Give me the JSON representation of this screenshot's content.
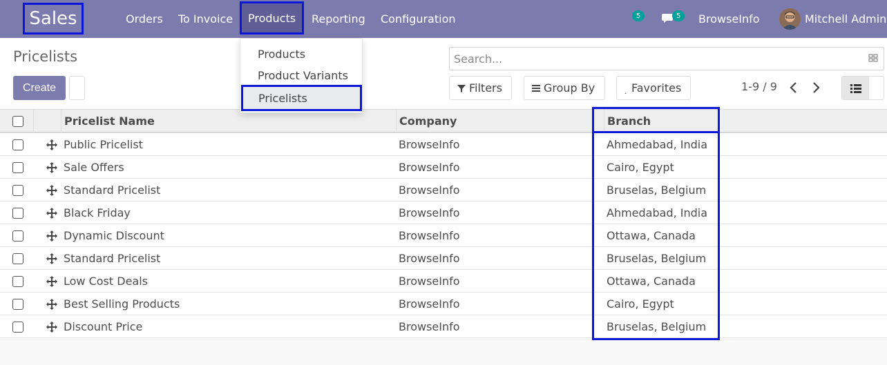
{
  "app": {
    "title": "Sales"
  },
  "nav": {
    "menu": [
      "Orders",
      "To Invoice",
      "Products",
      "Reporting",
      "Configuration"
    ],
    "activity_count": "5",
    "messages_count": "5",
    "company": "BrowseInfo",
    "user": "Mitchell Admin"
  },
  "dropdown": {
    "items": [
      "Products",
      "Product Variants",
      "Pricelists"
    ],
    "active": "Pricelists"
  },
  "page": {
    "title": "Pricelists",
    "create_label": "Create"
  },
  "search": {
    "placeholder": "Search..."
  },
  "controls": {
    "filters": "Filters",
    "group_by": "Group By",
    "favorites": "Favorites",
    "pager": "1-9 / 9"
  },
  "table": {
    "headers": [
      "Pricelist Name",
      "Company",
      "Branch"
    ],
    "rows": [
      [
        "Public Pricelist",
        "BrowseInfo",
        "Ahmedabad, India"
      ],
      [
        "Sale Offers",
        "BrowseInfo",
        "Cairo, Egypt"
      ],
      [
        "Standard Pricelist",
        "BrowseInfo",
        "Bruselas, Belgium"
      ],
      [
        "Black Friday",
        "BrowseInfo",
        "Ahmedabad, India"
      ],
      [
        "Dynamic Discount",
        "BrowseInfo",
        "Ottawa, Canada"
      ],
      [
        "Standard Pricelist",
        "BrowseInfo",
        "Bruselas, Belgium"
      ],
      [
        "Low Cost Deals",
        "BrowseInfo",
        "Ottawa, Canada"
      ],
      [
        "Best Selling Products",
        "BrowseInfo",
        "Cairo, Egypt"
      ],
      [
        "Discount Price",
        "BrowseInfo",
        "Bruselas, Belgium"
      ]
    ]
  },
  "colors": {
    "navbar": "#7c7bad",
    "highlight": "#0a16d8",
    "badge": "#00a09d"
  },
  "icons": [
    "chat-icon",
    "search-toggle-icon",
    "filter-icon",
    "group-by-icon",
    "favorites-icon",
    "chevron-left-icon",
    "chevron-right-icon",
    "list-view-icon",
    "drag-handle-icon"
  ]
}
